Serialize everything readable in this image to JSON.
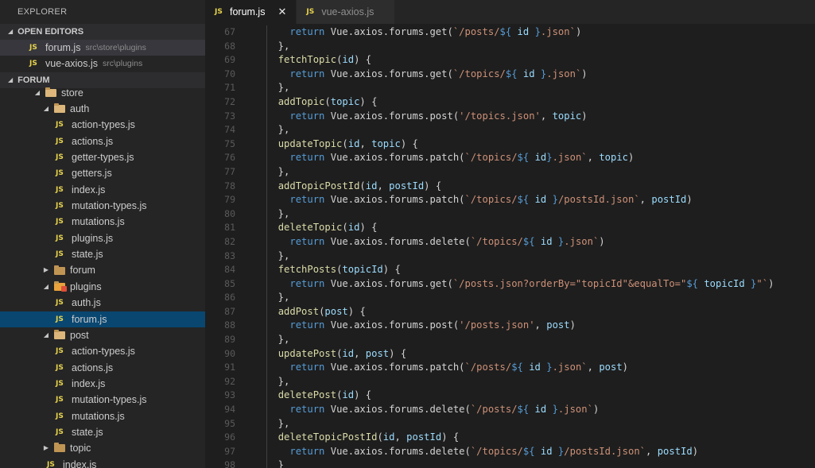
{
  "sidebar": {
    "title": "EXPLORER",
    "open_editors": {
      "header": "OPEN EDITORS",
      "items": [
        {
          "name": "forum.js",
          "path": "src\\store\\plugins",
          "active": true
        },
        {
          "name": "vue-axios.js",
          "path": "src\\plugins",
          "active": false
        }
      ]
    },
    "project": {
      "header": "FORUM",
      "tree": [
        {
          "label": "store",
          "type": "folder",
          "depth": 0,
          "expanded": true,
          "icon": "folder-open-icon"
        },
        {
          "label": "auth",
          "type": "folder",
          "depth": 1,
          "expanded": true,
          "icon": "folder-open-icon"
        },
        {
          "label": "action-types.js",
          "type": "file",
          "depth": 2
        },
        {
          "label": "actions.js",
          "type": "file",
          "depth": 2
        },
        {
          "label": "getter-types.js",
          "type": "file",
          "depth": 2
        },
        {
          "label": "getters.js",
          "type": "file",
          "depth": 2
        },
        {
          "label": "index.js",
          "type": "file",
          "depth": 2
        },
        {
          "label": "mutation-types.js",
          "type": "file",
          "depth": 2
        },
        {
          "label": "mutations.js",
          "type": "file",
          "depth": 2
        },
        {
          "label": "plugins.js",
          "type": "file",
          "depth": 2
        },
        {
          "label": "state.js",
          "type": "file",
          "depth": 2
        },
        {
          "label": "forum",
          "type": "folder",
          "depth": 1,
          "expanded": false,
          "icon": "folder-icon"
        },
        {
          "label": "plugins",
          "type": "folder",
          "depth": 1,
          "expanded": true,
          "icon": "plugins-folder-icon"
        },
        {
          "label": "auth.js",
          "type": "file",
          "depth": 2
        },
        {
          "label": "forum.js",
          "type": "file",
          "depth": 2,
          "selected": true
        },
        {
          "label": "post",
          "type": "folder",
          "depth": 1,
          "expanded": true,
          "icon": "folder-open-icon"
        },
        {
          "label": "action-types.js",
          "type": "file",
          "depth": 2
        },
        {
          "label": "actions.js",
          "type": "file",
          "depth": 2
        },
        {
          "label": "index.js",
          "type": "file",
          "depth": 2
        },
        {
          "label": "mutation-types.js",
          "type": "file",
          "depth": 2
        },
        {
          "label": "mutations.js",
          "type": "file",
          "depth": 2
        },
        {
          "label": "state.js",
          "type": "file",
          "depth": 2
        },
        {
          "label": "topic",
          "type": "folder",
          "depth": 1,
          "expanded": false,
          "icon": "folder-icon"
        },
        {
          "label": "index.js",
          "type": "file",
          "depth": 1
        }
      ]
    }
  },
  "tabs": [
    {
      "label": "forum.js",
      "active": true,
      "close": "✕"
    },
    {
      "label": "vue-axios.js",
      "active": false
    }
  ],
  "file_badge": "JS",
  "colors": {
    "function": "#dcdcaa",
    "keyword": "#569cd6",
    "parameter": "#9cdcfe",
    "string": "#ce9178",
    "selection": "#094771",
    "js_badge": "#e8d44d"
  },
  "code": {
    "lines": [
      {
        "n": "67",
        "tokens": [
          [
            "    ",
            "d"
          ],
          [
            "return",
            "kw"
          ],
          [
            " Vue.axios.forums.get(",
            "d"
          ],
          [
            "`/posts/",
            "s"
          ],
          [
            "${ ",
            "i"
          ],
          [
            "id",
            "p"
          ],
          [
            " }",
            "i"
          ],
          [
            ".json`",
            "s"
          ],
          [
            ")",
            "d"
          ]
        ]
      },
      {
        "n": "68",
        "tokens": [
          [
            "  },",
            "d"
          ]
        ]
      },
      {
        "n": "69",
        "tokens": [
          [
            "  ",
            "d"
          ],
          [
            "fetchTopic",
            "fn"
          ],
          [
            "(",
            "d"
          ],
          [
            "id",
            "p"
          ],
          [
            ") {",
            "d"
          ]
        ]
      },
      {
        "n": "70",
        "tokens": [
          [
            "    ",
            "d"
          ],
          [
            "return",
            "kw"
          ],
          [
            " Vue.axios.forums.get(",
            "d"
          ],
          [
            "`/topics/",
            "s"
          ],
          [
            "${ ",
            "i"
          ],
          [
            "id",
            "p"
          ],
          [
            " }",
            "i"
          ],
          [
            ".json`",
            "s"
          ],
          [
            ")",
            "d"
          ]
        ]
      },
      {
        "n": "71",
        "tokens": [
          [
            "  },",
            "d"
          ]
        ]
      },
      {
        "n": "72",
        "tokens": [
          [
            "  ",
            "d"
          ],
          [
            "addTopic",
            "fn"
          ],
          [
            "(",
            "d"
          ],
          [
            "topic",
            "p"
          ],
          [
            ") {",
            "d"
          ]
        ]
      },
      {
        "n": "73",
        "tokens": [
          [
            "    ",
            "d"
          ],
          [
            "return",
            "kw"
          ],
          [
            " Vue.axios.forums.post(",
            "d"
          ],
          [
            "'/topics.json'",
            "s"
          ],
          [
            ", ",
            "d"
          ],
          [
            "topic",
            "p"
          ],
          [
            ")",
            "d"
          ]
        ]
      },
      {
        "n": "74",
        "tokens": [
          [
            "  },",
            "d"
          ]
        ]
      },
      {
        "n": "75",
        "tokens": [
          [
            "  ",
            "d"
          ],
          [
            "updateTopic",
            "fn"
          ],
          [
            "(",
            "d"
          ],
          [
            "id",
            "p"
          ],
          [
            ", ",
            "d"
          ],
          [
            "topic",
            "p"
          ],
          [
            ") {",
            "d"
          ]
        ]
      },
      {
        "n": "76",
        "tokens": [
          [
            "    ",
            "d"
          ],
          [
            "return",
            "kw"
          ],
          [
            " Vue.axios.forums.patch(",
            "d"
          ],
          [
            "`/topics/",
            "s"
          ],
          [
            "${ ",
            "i"
          ],
          [
            "id",
            "p"
          ],
          [
            "}",
            "i"
          ],
          [
            ".json`",
            "s"
          ],
          [
            ", ",
            "d"
          ],
          [
            "topic",
            "p"
          ],
          [
            ")",
            "d"
          ]
        ]
      },
      {
        "n": "77",
        "tokens": [
          [
            "  },",
            "d"
          ]
        ]
      },
      {
        "n": "78",
        "tokens": [
          [
            "  ",
            "d"
          ],
          [
            "addTopicPostId",
            "fn"
          ],
          [
            "(",
            "d"
          ],
          [
            "id",
            "p"
          ],
          [
            ", ",
            "d"
          ],
          [
            "postId",
            "p"
          ],
          [
            ") {",
            "d"
          ]
        ]
      },
      {
        "n": "79",
        "tokens": [
          [
            "    ",
            "d"
          ],
          [
            "return",
            "kw"
          ],
          [
            " Vue.axios.forums.patch(",
            "d"
          ],
          [
            "`/topics/",
            "s"
          ],
          [
            "${ ",
            "i"
          ],
          [
            "id",
            "p"
          ],
          [
            " }",
            "i"
          ],
          [
            "/postsId.json`",
            "s"
          ],
          [
            ", ",
            "d"
          ],
          [
            "postId",
            "p"
          ],
          [
            ")",
            "d"
          ]
        ]
      },
      {
        "n": "80",
        "tokens": [
          [
            "  },",
            "d"
          ]
        ]
      },
      {
        "n": "81",
        "tokens": [
          [
            "  ",
            "d"
          ],
          [
            "deleteTopic",
            "fn"
          ],
          [
            "(",
            "d"
          ],
          [
            "id",
            "p"
          ],
          [
            ") {",
            "d"
          ]
        ]
      },
      {
        "n": "82",
        "tokens": [
          [
            "    ",
            "d"
          ],
          [
            "return",
            "kw"
          ],
          [
            " Vue.axios.forums.delete(",
            "d"
          ],
          [
            "`/topics/",
            "s"
          ],
          [
            "${ ",
            "i"
          ],
          [
            "id",
            "p"
          ],
          [
            " }",
            "i"
          ],
          [
            ".json`",
            "s"
          ],
          [
            ")",
            "d"
          ]
        ]
      },
      {
        "n": "83",
        "tokens": [
          [
            "  },",
            "d"
          ]
        ]
      },
      {
        "n": "84",
        "tokens": [
          [
            "  ",
            "d"
          ],
          [
            "fetchPosts",
            "fn"
          ],
          [
            "(",
            "d"
          ],
          [
            "topicId",
            "p"
          ],
          [
            ") {",
            "d"
          ]
        ]
      },
      {
        "n": "85",
        "tokens": [
          [
            "    ",
            "d"
          ],
          [
            "return",
            "kw"
          ],
          [
            " Vue.axios.forums.get(",
            "d"
          ],
          [
            "`/posts.json?orderBy=\"topicId\"&equalTo=\"",
            "s"
          ],
          [
            "${ ",
            "i"
          ],
          [
            "topicId",
            "p"
          ],
          [
            " }",
            "i"
          ],
          [
            "\"`",
            "s"
          ],
          [
            ")",
            "d"
          ]
        ]
      },
      {
        "n": "86",
        "tokens": [
          [
            "  },",
            "d"
          ]
        ]
      },
      {
        "n": "87",
        "tokens": [
          [
            "  ",
            "d"
          ],
          [
            "addPost",
            "fn"
          ],
          [
            "(",
            "d"
          ],
          [
            "post",
            "p"
          ],
          [
            ") {",
            "d"
          ]
        ]
      },
      {
        "n": "88",
        "tokens": [
          [
            "    ",
            "d"
          ],
          [
            "return",
            "kw"
          ],
          [
            " Vue.axios.forums.post(",
            "d"
          ],
          [
            "'/posts.json'",
            "s"
          ],
          [
            ", ",
            "d"
          ],
          [
            "post",
            "p"
          ],
          [
            ")",
            "d"
          ]
        ]
      },
      {
        "n": "89",
        "tokens": [
          [
            "  },",
            "d"
          ]
        ]
      },
      {
        "n": "90",
        "tokens": [
          [
            "  ",
            "d"
          ],
          [
            "updatePost",
            "fn"
          ],
          [
            "(",
            "d"
          ],
          [
            "id",
            "p"
          ],
          [
            ", ",
            "d"
          ],
          [
            "post",
            "p"
          ],
          [
            ") {",
            "d"
          ]
        ]
      },
      {
        "n": "91",
        "tokens": [
          [
            "    ",
            "d"
          ],
          [
            "return",
            "kw"
          ],
          [
            " Vue.axios.forums.patch(",
            "d"
          ],
          [
            "`/posts/",
            "s"
          ],
          [
            "${ ",
            "i"
          ],
          [
            "id",
            "p"
          ],
          [
            " }",
            "i"
          ],
          [
            ".json`",
            "s"
          ],
          [
            ", ",
            "d"
          ],
          [
            "post",
            "p"
          ],
          [
            ")",
            "d"
          ]
        ]
      },
      {
        "n": "92",
        "tokens": [
          [
            "  },",
            "d"
          ]
        ]
      },
      {
        "n": "93",
        "tokens": [
          [
            "  ",
            "d"
          ],
          [
            "deletePost",
            "fn"
          ],
          [
            "(",
            "d"
          ],
          [
            "id",
            "p"
          ],
          [
            ") {",
            "d"
          ]
        ]
      },
      {
        "n": "94",
        "tokens": [
          [
            "    ",
            "d"
          ],
          [
            "return",
            "kw"
          ],
          [
            " Vue.axios.forums.delete(",
            "d"
          ],
          [
            "`/posts/",
            "s"
          ],
          [
            "${ ",
            "i"
          ],
          [
            "id",
            "p"
          ],
          [
            " }",
            "i"
          ],
          [
            ".json`",
            "s"
          ],
          [
            ")",
            "d"
          ]
        ]
      },
      {
        "n": "95",
        "tokens": [
          [
            "  },",
            "d"
          ]
        ]
      },
      {
        "n": "96",
        "tokens": [
          [
            "  ",
            "d"
          ],
          [
            "deleteTopicPostId",
            "fn"
          ],
          [
            "(",
            "d"
          ],
          [
            "id",
            "p"
          ],
          [
            ", ",
            "d"
          ],
          [
            "postId",
            "p"
          ],
          [
            ") {",
            "d"
          ]
        ]
      },
      {
        "n": "97",
        "tokens": [
          [
            "    ",
            "d"
          ],
          [
            "return",
            "kw"
          ],
          [
            " Vue.axios.forums.delete(",
            "d"
          ],
          [
            "`/topics/",
            "s"
          ],
          [
            "${ ",
            "i"
          ],
          [
            "id",
            "p"
          ],
          [
            " }",
            "i"
          ],
          [
            "/postsId.json`",
            "s"
          ],
          [
            ", ",
            "d"
          ],
          [
            "postId",
            "p"
          ],
          [
            ")",
            "d"
          ]
        ]
      },
      {
        "n": "98",
        "tokens": [
          [
            "  }",
            "d"
          ]
        ]
      }
    ]
  }
}
